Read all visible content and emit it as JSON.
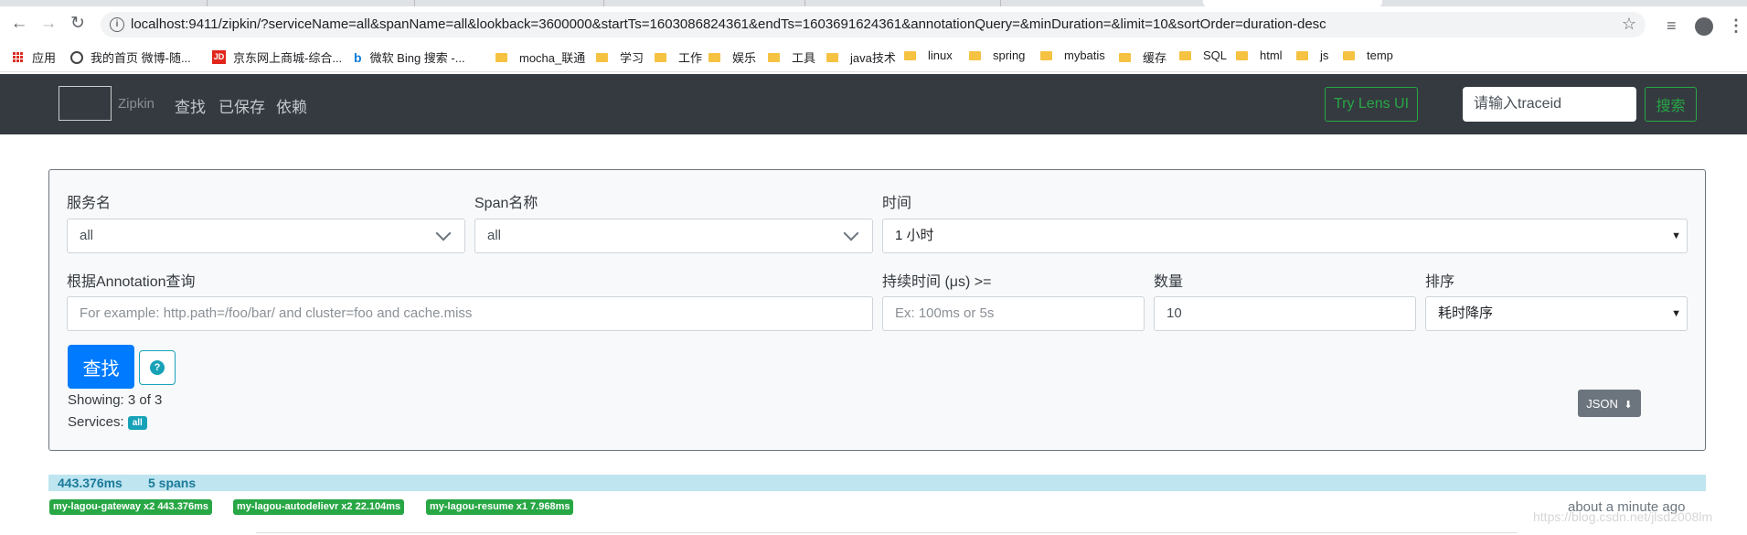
{
  "browser": {
    "url": "localhost:9411/zipkin/?serviceName=all&spanName=all&lookback=3600000&startTs=1603086824361&endTs=1603691624361&annotationQuery=&minDuration=&limit=10&sortOrder=duration-desc",
    "bookmarks": [
      {
        "label": "应用",
        "icon": "apps-icon"
      },
      {
        "label": "我的首页 微博-随...",
        "icon": "globe-icon"
      },
      {
        "label": "京东网上商城-综合...",
        "icon": "jd-icon"
      },
      {
        "label": "微软 Bing 搜索 -...",
        "icon": "bing-icon"
      },
      {
        "label": "mocha_联通",
        "icon": "folder-icon"
      },
      {
        "label": "学习",
        "icon": "folder-icon"
      },
      {
        "label": "工作",
        "icon": "folder-icon"
      },
      {
        "label": "娱乐",
        "icon": "folder-icon"
      },
      {
        "label": "工具",
        "icon": "folder-icon"
      },
      {
        "label": "java技术",
        "icon": "folder-icon"
      },
      {
        "label": "linux",
        "icon": "folder-icon"
      },
      {
        "label": "spring",
        "icon": "folder-icon"
      },
      {
        "label": "mybatis",
        "icon": "folder-icon"
      },
      {
        "label": "缓存",
        "icon": "folder-icon"
      },
      {
        "label": "SQL",
        "icon": "folder-icon"
      },
      {
        "label": "html",
        "icon": "folder-icon"
      },
      {
        "label": "js",
        "icon": "folder-icon"
      },
      {
        "label": "temp",
        "icon": "folder-icon"
      }
    ]
  },
  "navbar": {
    "brand": "Zipkin",
    "links": [
      "查找",
      "已保存",
      "依赖"
    ],
    "lens_button": "Try Lens UI",
    "traceid_placeholder": "请输入traceid",
    "search_button": "搜索"
  },
  "form": {
    "service_label": "服务名",
    "service_value": "all",
    "span_label": "Span名称",
    "span_value": "all",
    "time_label": "时间",
    "time_value": "1 小时",
    "annotation_label": "根据Annotation查询",
    "annotation_placeholder": "For example: http.path=/foo/bar/ and cluster=foo and cache.miss",
    "duration_label": "持续时间 (μs) >=",
    "duration_placeholder": "Ex: 100ms or 5s",
    "limit_label": "数量",
    "limit_value": "10",
    "sort_label": "排序",
    "sort_value": "耗时降序",
    "find_button": "查找",
    "help_icon": "?",
    "showing_text": "Showing: 3 of 3",
    "services_label": "Services:",
    "services_badge": "all",
    "json_button": "JSON"
  },
  "results": [
    {
      "duration": "443.376ms",
      "spans": "5 spans",
      "services": [
        "my-lagou-gateway x2 443.376ms",
        "my-lagou-autodelievr x2 22.104ms",
        "my-lagou-resume x1 7.968ms"
      ],
      "time_ago": "about a minute ago"
    }
  ],
  "watermark": "https://blog.csdn.net/jlsd2008lm",
  "colors": {
    "navbar": "#343a40",
    "primary": "#007bff",
    "success": "#28a745",
    "info": "#17a2b8",
    "result_bar": "#bee5f0"
  }
}
